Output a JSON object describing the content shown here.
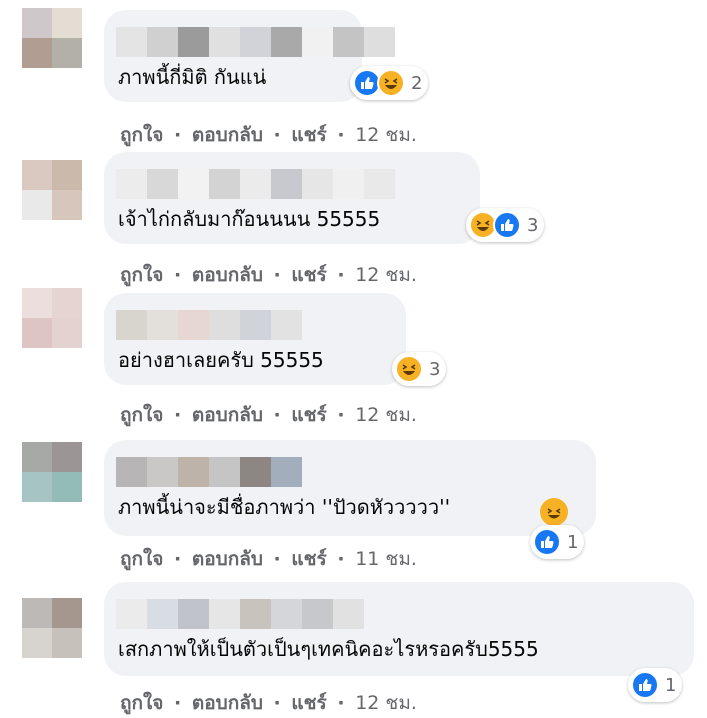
{
  "colors": {
    "bubble": "#f0f2f5",
    "meta": "#65676b",
    "like": "#1877f2",
    "haha": "#f7b125"
  },
  "actions": {
    "like": "ถูกใจ",
    "reply": "ตอบกลับ",
    "share": "แชร์",
    "sep": "·"
  },
  "comments": [
    {
      "text": "ภาพนี้กี่มิติ กันแน่",
      "reactions": [
        "like-icon",
        "haha-icon"
      ],
      "reaction_count": "2",
      "time": "12 ชม.",
      "avatar": [
        "#cfc8cb",
        "#e4ddd4",
        "#b29d92",
        "#b3b0a7"
      ],
      "name": [
        "#e4e4e4",
        "#d0d0d0",
        "#9b9b9b",
        "#e0e0e0",
        "#d2d3d8",
        "#a9a9a9",
        "#f1f1f1",
        "#c4c4c4",
        "#dedede"
      ]
    },
    {
      "text": "เจ้าไก่กลับมาก๊อนนนน 55555",
      "reactions": [
        "haha-icon",
        "like-icon"
      ],
      "reaction_count": "3",
      "time": "12 ชม.",
      "avatar": [
        "#d9c9c0",
        "#cbb9ac",
        "#e9e9e9",
        "#d7c6bc"
      ],
      "name": [
        "#ececec",
        "#d8d8d8",
        "#f2f2f2",
        "#d3d3d3",
        "#ebebeb",
        "#c7c9ce",
        "#e6e6e6",
        "#f0f0f0",
        "#e9e9e9"
      ]
    },
    {
      "text": "อย่างฮาเลยครับ 55555",
      "reactions": [
        "haha-icon"
      ],
      "reaction_count": "3",
      "time": "12 ชม.",
      "avatar": [
        "#ecdedd",
        "#e6d4d2",
        "#dcc5c3",
        "#e3d2d0"
      ],
      "name": [
        "#d8d5cf",
        "#e3dfda",
        "#e6d7d3",
        "#dedede",
        "#d0d3d9",
        "#e2e2e2"
      ]
    },
    {
      "text": "ภาพนี้น่าจะมีชื่อภาพว่า ''ปัวดหัววววว''",
      "reactions": [
        "like-icon"
      ],
      "reaction_count": "1",
      "time": "11 ชม.",
      "avatar": [
        "#a7a9a6",
        "#9c9595",
        "#a6c4c4",
        "#93bcb8"
      ],
      "name": [
        "#b7b5b5",
        "#c9c8c6",
        "#bdb3a8",
        "#c5c5c5",
        "#8e8682",
        "#a3aebd"
      ]
    },
    {
      "text": "เสกภาพให้เป็นตัวเป็นๆเทคนิคอะไรหรอครับ5555",
      "reactions": [
        "like-icon"
      ],
      "reaction_count": "1",
      "time": "12 ชม.",
      "avatar": [
        "#bdb9b6",
        "#a5978e",
        "#d7d3cf",
        "#c7c1bc"
      ],
      "name": [
        "#ebebeb",
        "#d8dce3",
        "#c1c3cb",
        "#e6e6e6",
        "#c8c4bd",
        "#d4d6da",
        "#c7c8cc",
        "#e1e1e1"
      ]
    }
  ]
}
